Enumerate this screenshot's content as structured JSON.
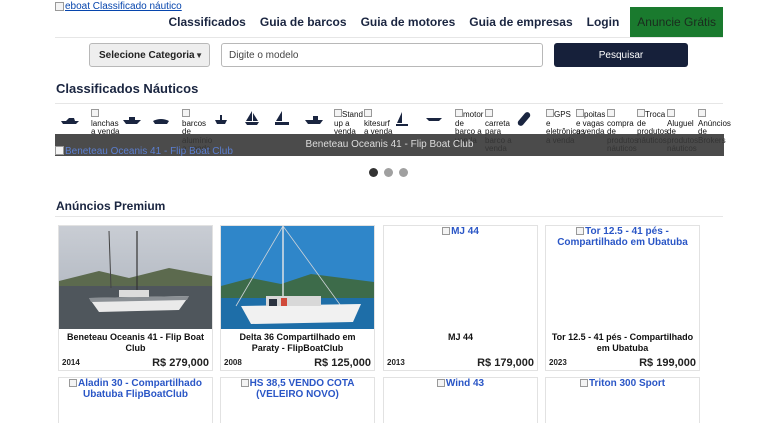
{
  "header": {
    "logo_alt": "eboat Classificado náutico",
    "nav": [
      "Classificados",
      "Guia de barcos",
      "Guia de motores",
      "Guia de empresas",
      "Login"
    ],
    "cta": "Anuncie Grátis",
    "cta_color": "#1a7a2e"
  },
  "search": {
    "category_label": "Selecione Categoria",
    "model_placeholder": "Digite o modelo",
    "button_label": "Pesquisar"
  },
  "classificados": {
    "title": "Classificados Náuticos",
    "categories": [
      {
        "icon": "speedboat-icon",
        "label": ""
      },
      {
        "icon": "",
        "label": "lanchas a venda"
      },
      {
        "icon": "boat-icon",
        "label": ""
      },
      {
        "icon": "jetski-icon",
        "label": ""
      },
      {
        "icon": "",
        "label": "barcos de alumínio a venda"
      },
      {
        "icon": "inflatable-icon",
        "label": ""
      },
      {
        "icon": "sailboat-icon",
        "label": ""
      },
      {
        "icon": "catamaran-icon",
        "label": ""
      },
      {
        "icon": "fishing-boat-icon",
        "label": ""
      },
      {
        "icon": "",
        "label": "Stand up a venda"
      },
      {
        "icon": "",
        "label": "kitesurf a venda"
      },
      {
        "icon": "windsurf-icon",
        "label": ""
      },
      {
        "icon": "canoe-icon",
        "label": ""
      },
      {
        "icon": "",
        "label": "motor de barco a venda"
      },
      {
        "icon": "",
        "label": "carreta para barco a venda"
      },
      {
        "icon": "wakeboard-icon",
        "label": ""
      },
      {
        "icon": "",
        "label": "GPS e eletrônicos a venda"
      },
      {
        "icon": "",
        "label": "poitas e vagas a venda"
      },
      {
        "icon": "",
        "label": "compra de produtos náuticos"
      },
      {
        "icon": "",
        "label": "Troca de produtos náuticos"
      },
      {
        "icon": "",
        "label": "Aluguel de produtos náuticos"
      },
      {
        "icon": "",
        "label": "Anúncios de Brokers"
      }
    ],
    "slider_caption": "Beneteau Oceanis 41 - Flip Boat Club",
    "slider_alt": "Beneteau Oceanis 41 - Flip Boat Club"
  },
  "premium": {
    "title": "Anúncios Premium",
    "cards": [
      {
        "name": "Beneteau Oceanis 41 - Flip Boat Club",
        "year": "2014",
        "price": "R$ 279,000",
        "alt": ""
      },
      {
        "name": "Delta 36 Compartilhado em Paraty - FlipBoatClub",
        "year": "2008",
        "price": "R$ 125,000",
        "alt": ""
      },
      {
        "name": "MJ 44",
        "year": "2013",
        "price": "R$ 179,000",
        "alt": "MJ 44"
      },
      {
        "name": "Tor 12.5 - 41 pés - Compartilhado em Ubatuba",
        "year": "2023",
        "price": "R$ 199,000",
        "alt": "Tor 12.5 - 41 pés - Compartilhado em Ubatuba"
      }
    ],
    "cards_row2": [
      {
        "alt": "Aladin 30 - Compartilhado Ubatuba FlipBoatClub"
      },
      {
        "alt": "HS 38,5 VENDO COTA (VELEIRO NOVO)"
      },
      {
        "alt": "Wind 43"
      },
      {
        "alt": "Triton 300 Sport"
      }
    ]
  }
}
